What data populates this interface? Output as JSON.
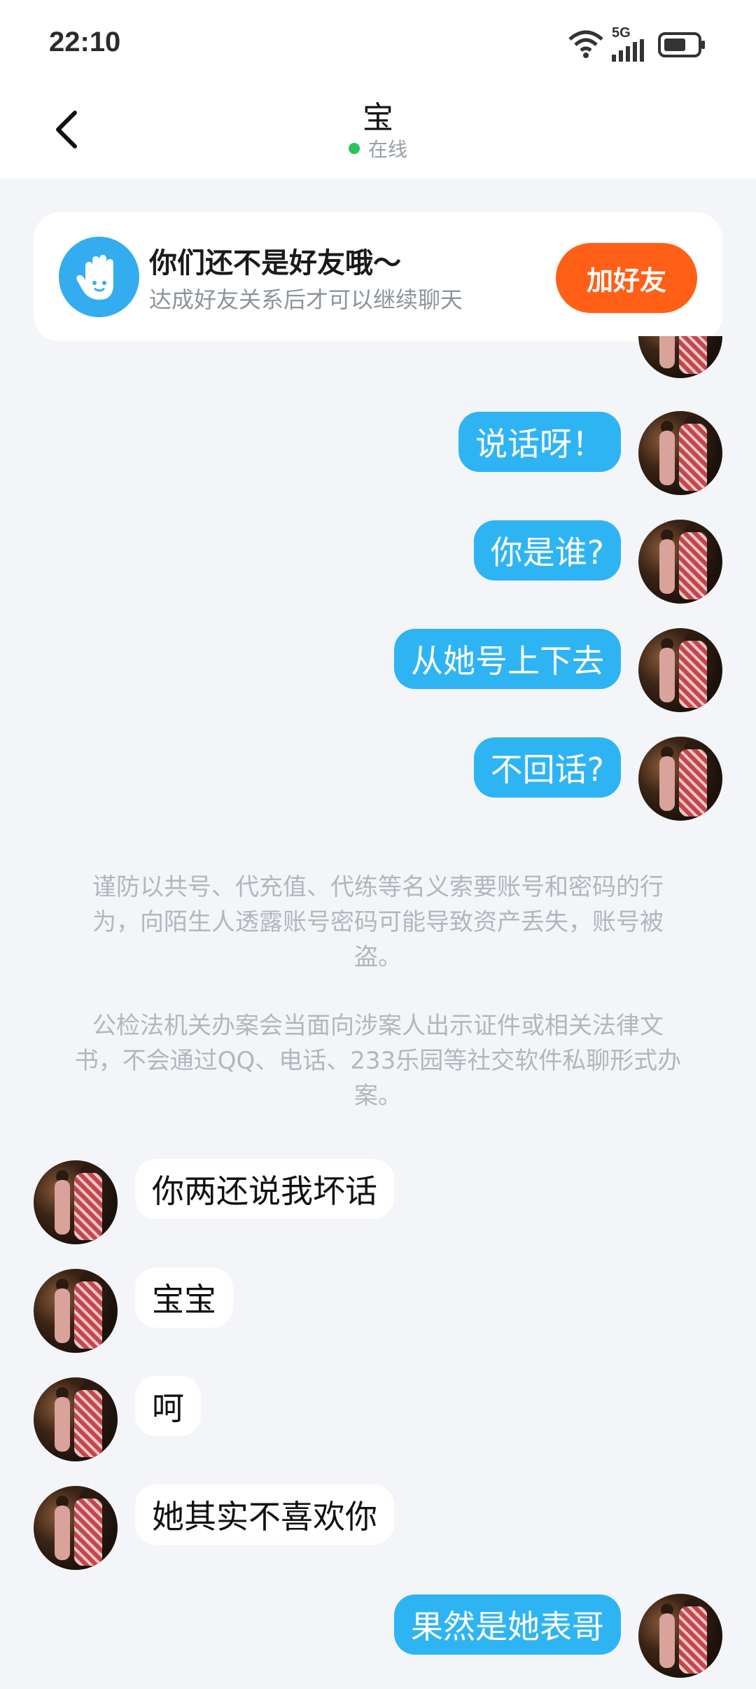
{
  "status_bar": {
    "time": "22:10",
    "network": "5G",
    "icons": [
      "wifi-icon",
      "signal-icon",
      "battery-icon"
    ]
  },
  "header": {
    "title": "宝",
    "status_text": "在线",
    "status_color": "#2cc35b"
  },
  "friend_card": {
    "title": "你们还不是好友哦～",
    "subtitle": "达成好友关系后才可以继续聊天",
    "button_label": "加好友",
    "button_color": "#ff5f17",
    "icon": "hand-icon"
  },
  "messages_sent_top": [
    {
      "text": "说话呀！"
    },
    {
      "text": "你是谁?"
    },
    {
      "text": "从她号上下去"
    },
    {
      "text": "不回话?"
    }
  ],
  "notices": [
    "谨防以共号、代充值、代练等名义索要账号和密码的行为，向陌生人透露账号密码可能导致资产丢失，账号被盗。",
    "公检法机关办案会当面向涉案人出示证件或相关法律文书，不会通过QQ、电话、233乐园等社交软件私聊形式办案。"
  ],
  "messages_received": [
    {
      "text": "你两还说我坏话"
    },
    {
      "text": "宝宝"
    },
    {
      "text": "呵"
    },
    {
      "text": "她其实不喜欢你"
    }
  ],
  "messages_sent_bottom": [
    {
      "text": "果然是她表哥"
    }
  ],
  "colors": {
    "sent_bubble": "#2fb4f3",
    "received_bubble": "#ffffff",
    "background": "#f3f5f8"
  }
}
